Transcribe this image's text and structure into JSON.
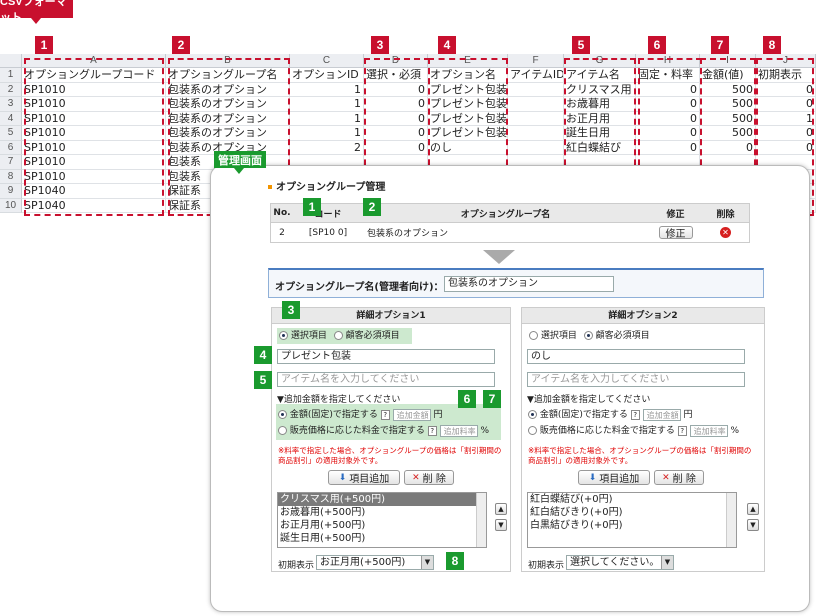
{
  "csv_tag": "CSVフォーマット",
  "admin_tag": "管理画面",
  "col_numbers": [
    "1",
    "2",
    "3",
    "4",
    "5",
    "6",
    "7",
    "8"
  ],
  "sheet": {
    "col_letters": [
      "A",
      "B",
      "C",
      "D",
      "E",
      "F",
      "G",
      "H",
      "I",
      "J"
    ],
    "header_row": [
      "オプショングループコード",
      "オプショングループ名",
      "オプションID",
      "選択・必須",
      "オプション名",
      "アイテムID",
      "アイテム名",
      "固定・料率",
      "金額(値)",
      "初期表示"
    ],
    "rows": [
      [
        "SP1010",
        "包装系のオプション",
        "1",
        "0",
        "プレゼント包装",
        "",
        "クリスマス用",
        "0",
        "500",
        "0"
      ],
      [
        "SP1010",
        "包装系のオプション",
        "1",
        "0",
        "プレゼント包装",
        "",
        "お歳暮用",
        "0",
        "500",
        "0"
      ],
      [
        "SP1010",
        "包装系のオプション",
        "1",
        "0",
        "プレゼント包装",
        "",
        "お正月用",
        "0",
        "500",
        "1"
      ],
      [
        "SP1010",
        "包装系のオプション",
        "1",
        "0",
        "プレゼント包装",
        "",
        "誕生日用",
        "0",
        "500",
        "0"
      ],
      [
        "SP1010",
        "包装系のオプション",
        "2",
        "0",
        "のし",
        "",
        "紅白蝶結び",
        "0",
        "0",
        "0"
      ],
      [
        "SP1010",
        "包装系",
        "",
        "",
        "",
        "",
        "",
        "",
        "",
        ""
      ],
      [
        "SP1010",
        "包装系",
        "",
        "",
        "",
        "",
        "",
        "",
        "",
        ""
      ],
      [
        "SP1040",
        "保証系",
        "",
        "",
        "",
        "",
        "",
        "",
        "",
        ""
      ],
      [
        "SP1040",
        "保証系",
        "",
        "",
        "",
        "",
        "",
        "",
        "",
        ""
      ]
    ],
    "row_numbers": [
      "1",
      "2",
      "3",
      "4",
      "5",
      "6",
      "7",
      "8",
      "9",
      "10"
    ]
  },
  "admin": {
    "section_title": "オプショングループ管理",
    "table_headers": {
      "no": "No.",
      "code": "コード",
      "name": "オプショングループ名",
      "edit": "修正",
      "delete": "削除"
    },
    "table_row": {
      "no": "2",
      "code": "[SP10 0]",
      "name": "包装系のオプション",
      "edit_btn": "修正"
    },
    "group_name_label": "オプショングループ名(管理者向け)：",
    "group_name_value": "包装系のオプション",
    "detail1": {
      "title": "詳細オプション1",
      "radio1": "選択項目",
      "radio2": "顧客必須項目",
      "option_name": "プレゼント包装",
      "item_placeholder": "アイテム名を入力してください",
      "amount_heading": "▼追加金額を指定してください",
      "fixed_label": "金額(固定)で指定する",
      "rate_label": "販売価格に応じた料金で指定する",
      "amount_placeholder": "追加金額",
      "rate_placeholder": "追加料率",
      "yen": "円",
      "pct": "%",
      "help": "?",
      "note": "※料率で指定した場合、オプショングループの価格は「割引期間の商品割引」の適用対象外です。",
      "add_btn": "項目追加",
      "del_btn": "削 除",
      "items": [
        "クリスマス用(+500円)",
        "お歳暮用(+500円)",
        "お正月用(+500円)",
        "誕生日用(+500円)"
      ],
      "initial_label": "初期表示",
      "initial_value": "お正月用(+500円)"
    },
    "detail2": {
      "title": "詳細オプション2",
      "radio1": "選択項目",
      "radio2": "顧客必須項目",
      "option_name": "のし",
      "item_placeholder": "アイテム名を入力してください",
      "amount_heading": "▼追加金額を指定してください",
      "fixed_label": "金額(固定)で指定する",
      "rate_label": "販売価格に応じた料金で指定する",
      "amount_placeholder": "追加金額",
      "rate_placeholder": "追加料率",
      "yen": "円",
      "pct": "%",
      "help": "?",
      "note": "※料率で指定した場合、オプショングループの価格は「割引期間の商品割引」の適用対象外です。",
      "add_btn": "項目追加",
      "del_btn": "削 除",
      "items": [
        "紅白蝶結び(+0円)",
        "紅白結びきり(+0円)",
        "白黒結びきり(+0円)"
      ],
      "initial_label": "初期表示",
      "initial_value": "選択してください。"
    },
    "badges": [
      "1",
      "2",
      "3",
      "4",
      "5",
      "6",
      "7",
      "8"
    ]
  }
}
